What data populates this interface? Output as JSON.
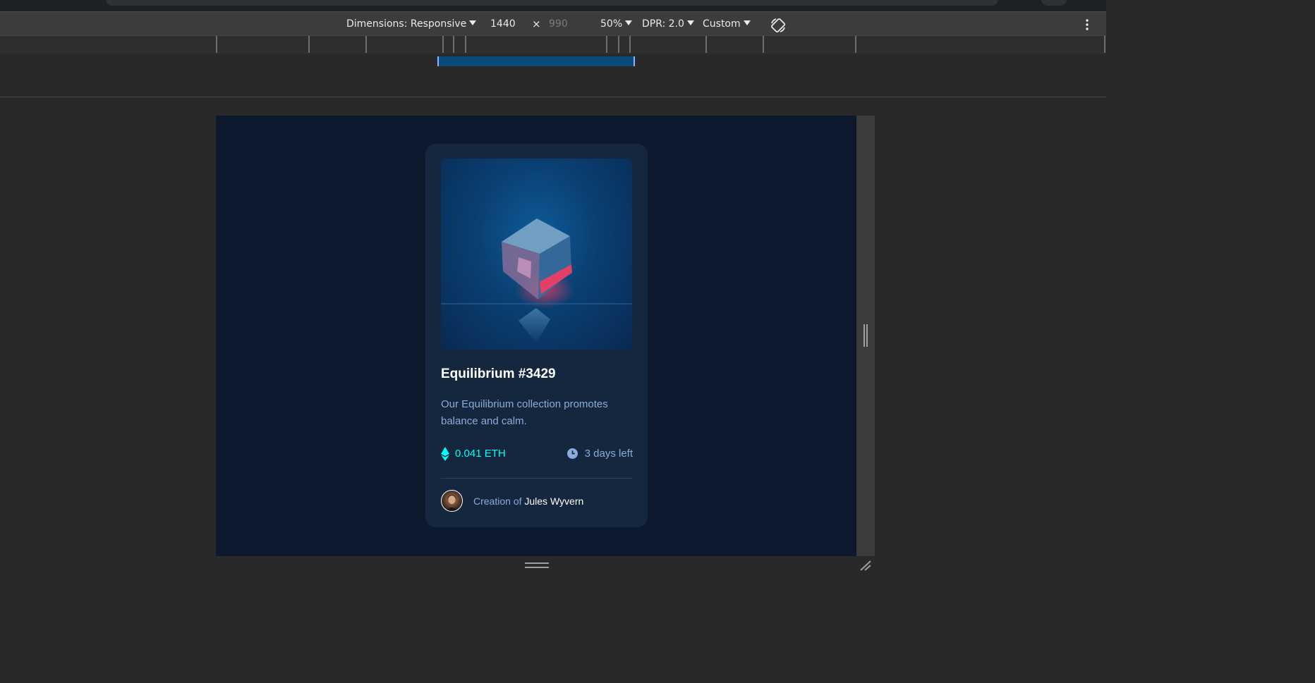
{
  "device_toolbar": {
    "dimensions_label": "Dimensions: Responsive",
    "width_value": "1440",
    "times": "×",
    "height_value": "990",
    "zoom": "50%",
    "dpr": "DPR: 2.0",
    "throttle": "Custom"
  },
  "card": {
    "title": "Equilibrium #3429",
    "description": "Our Equilibrium collection promotes balance and calm.",
    "price": "0.041 ETH",
    "time_left": "3 days left",
    "creator_prefix": "Creation of",
    "creator_name": "Jules Wyvern"
  },
  "colors": {
    "page_bg": "#0d192c",
    "card_bg": "#15263f",
    "accent_cyan": "#00fff8",
    "soft_blue": "#8bacd9",
    "white": "#ffffff"
  },
  "icons": {
    "eth": "ethereum-icon",
    "clock": "clock-icon",
    "rotate": "rotate-icon",
    "more": "kebab-icon"
  }
}
